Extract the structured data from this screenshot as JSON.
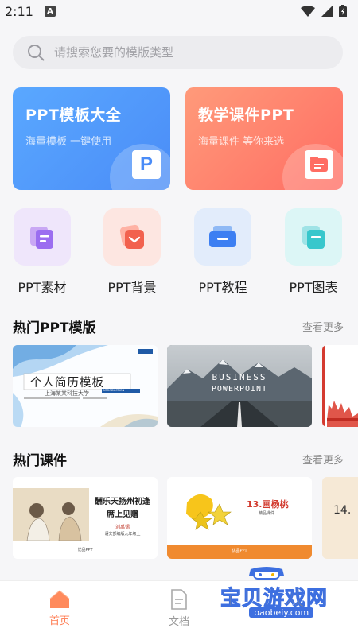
{
  "status": {
    "time": "2:11",
    "badge": "A"
  },
  "search": {
    "placeholder": "请搜索您要的模版类型"
  },
  "banners": [
    {
      "title": "PPT模板大全",
      "subtitle": "海量模板  一键使用",
      "icon": "P"
    },
    {
      "title": "教学课件PPT",
      "subtitle": "海量课件  等你来选"
    }
  ],
  "categories": [
    {
      "label": "PPT素材",
      "icon": "material-icon"
    },
    {
      "label": "PPT背景",
      "icon": "background-icon"
    },
    {
      "label": "PPT教程",
      "icon": "tutorial-icon"
    },
    {
      "label": "PPT图表",
      "icon": "chart-icon"
    }
  ],
  "hot_templates": {
    "title": "热门PPT模版",
    "more": "查看更多",
    "items": [
      {
        "title": "个人简历模板",
        "subtitle": "上海某某科技大学",
        "tag": "INTRODUCTION"
      },
      {
        "title": "BUSINESS",
        "subtitle": "POWERPOINT"
      }
    ]
  },
  "hot_courseware": {
    "title": "热门课件",
    "more": "查看更多",
    "items": [
      {
        "title": "酬乐天扬州初逢席上见赠",
        "author": "刘禹锡",
        "grade": "语文部编版九年级上",
        "footer": "优品PPT"
      },
      {
        "title": "13.画杨桃",
        "sub": "精品课件",
        "footer": "优品PPT"
      },
      {
        "title": "14."
      }
    ]
  },
  "tabs": [
    {
      "label": "首页",
      "active": true
    },
    {
      "label": "文档",
      "active": false
    }
  ],
  "watermark": {
    "text": "宝贝游戏网",
    "url": "baobeiy.com"
  },
  "colors": {
    "accent": "#ff7a4f",
    "blue": "#4a8cf7",
    "red": "#ff6d63"
  }
}
